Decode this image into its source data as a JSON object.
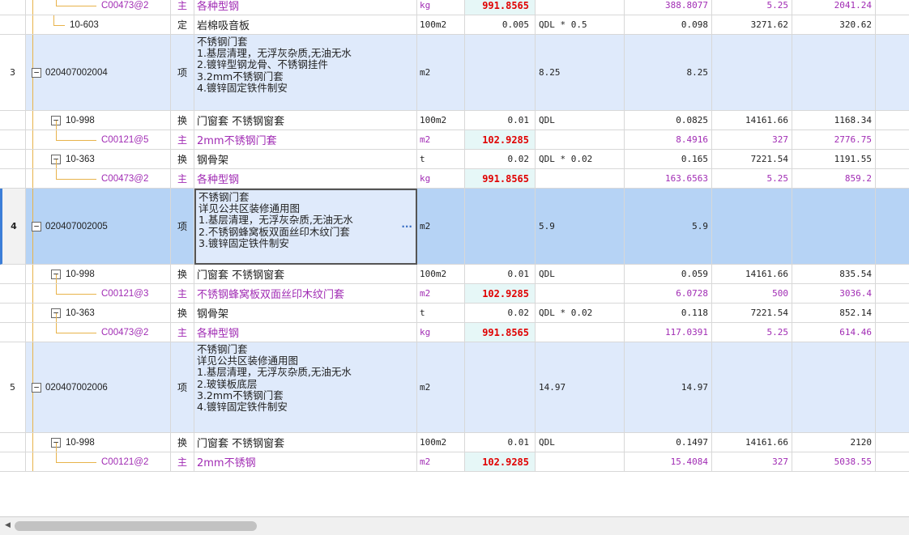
{
  "rows": [
    {
      "kind": "material",
      "idx": "",
      "code": "C00473@2",
      "type": "主",
      "name": "各种型钢",
      "unit": "kg",
      "content": "991.8565",
      "expr": "",
      "qty": "388.8077",
      "price": "5.25",
      "total": "2041.24"
    },
    {
      "kind": "quota",
      "idx": "",
      "code": "10-603",
      "type": "定",
      "name": "岩棉吸音板",
      "unit": "100m2",
      "content": "0.005",
      "expr": "QDL * 0.5",
      "qty": "0.098",
      "price": "3271.62",
      "total": "320.62"
    },
    {
      "kind": "item",
      "idx": "3",
      "code": "020407002004",
      "type": "项",
      "name": "不锈钢门套\n1.基层清理，无浮灰杂质,无油无水\n2.镀锌型钢龙骨、不锈钢挂件\n3.2mm不锈钢门套\n4.镀锌固定铁件制安",
      "unit": "m2",
      "content": "",
      "expr": "8.25",
      "qty": "8.25",
      "price": "",
      "total": ""
    },
    {
      "kind": "quota",
      "idx": "",
      "code": "10-998",
      "type": "换",
      "name": "门窗套 不锈钢窗套",
      "unit": "100m2",
      "content": "0.01",
      "expr": "QDL",
      "qty": "0.0825",
      "price": "14161.66",
      "total": "1168.34"
    },
    {
      "kind": "material",
      "idx": "",
      "code": "C00121@5",
      "type": "主",
      "name": "2mm不锈钢门套",
      "unit": "m2",
      "content": "102.9285",
      "expr": "",
      "qty": "8.4916",
      "price": "327",
      "total": "2776.75"
    },
    {
      "kind": "quota",
      "idx": "",
      "code": "10-363",
      "type": "换",
      "name": "钢骨架",
      "unit": "t",
      "content": "0.02",
      "expr": "QDL * 0.02",
      "qty": "0.165",
      "price": "7221.54",
      "total": "1191.55"
    },
    {
      "kind": "material",
      "idx": "",
      "code": "C00473@2",
      "type": "主",
      "name": "各种型钢",
      "unit": "kg",
      "content": "991.8565",
      "expr": "",
      "qty": "163.6563",
      "price": "5.25",
      "total": "859.2"
    },
    {
      "kind": "item selected",
      "idx": "4",
      "code": "020407002005",
      "type": "项",
      "name": "不锈钢门套\n详见公共区装修通用图\n1.基层清理，无浮灰杂质,无油无水\n2.不锈钢蜂窝板双面丝印木纹门套\n3.镀锌固定铁件制安",
      "unit": "m2",
      "content": "",
      "expr": "5.9",
      "qty": "5.9",
      "price": "",
      "total": ""
    },
    {
      "kind": "quota",
      "idx": "",
      "code": "10-998",
      "type": "换",
      "name": "门窗套 不锈钢窗套",
      "unit": "100m2",
      "content": "0.01",
      "expr": "QDL",
      "qty": "0.059",
      "price": "14161.66",
      "total": "835.54"
    },
    {
      "kind": "material",
      "idx": "",
      "code": "C00121@3",
      "type": "主",
      "name": "不锈钢蜂窝板双面丝印木纹门套",
      "unit": "m2",
      "content": "102.9285",
      "expr": "",
      "qty": "6.0728",
      "price": "500",
      "total": "3036.4"
    },
    {
      "kind": "quota",
      "idx": "",
      "code": "10-363",
      "type": "换",
      "name": "钢骨架",
      "unit": "t",
      "content": "0.02",
      "expr": "QDL * 0.02",
      "qty": "0.118",
      "price": "7221.54",
      "total": "852.14"
    },
    {
      "kind": "material",
      "idx": "",
      "code": "C00473@2",
      "type": "主",
      "name": "各种型钢",
      "unit": "kg",
      "content": "991.8565",
      "expr": "",
      "qty": "117.0391",
      "price": "5.25",
      "total": "614.46"
    },
    {
      "kind": "item",
      "idx": "5",
      "code": "020407002006",
      "type": "项",
      "name": "不锈钢门套\n详见公共区装修通用图\n1.基层清理，无浮灰杂质,无油无水\n2.玻镁板底层\n3.2mm不锈钢门套\n4.镀锌固定铁件制安",
      "unit": "m2",
      "content": "",
      "expr": "14.97",
      "qty": "14.97",
      "price": "",
      "total": ""
    },
    {
      "kind": "quota",
      "idx": "",
      "code": "10-998",
      "type": "换",
      "name": "门窗套 不锈钢窗套",
      "unit": "100m2",
      "content": "0.01",
      "expr": "QDL",
      "qty": "0.1497",
      "price": "14161.66",
      "total": "2120"
    },
    {
      "kind": "material",
      "idx": "",
      "code": "C00121@2",
      "type": "主",
      "name": "2mm不锈钢",
      "unit": "m2",
      "content": "102.9285",
      "expr": "",
      "qty": "15.4084",
      "price": "327",
      "total": "5038.55"
    }
  ],
  "icons": {
    "expander": "minus-box-icon",
    "more": "ellipsis-icon",
    "scroll_left": "arrow-left-icon"
  },
  "expander_glyph": "−",
  "more_glyph": "···",
  "scroll_left_glyph": "◀",
  "colors": {
    "material_text": "#a12cb4",
    "content_highlight": "#e00000",
    "item_bg": "#dfeafb",
    "selected_bg": "#b6d3f5",
    "tree_line": "#e8b34b"
  }
}
